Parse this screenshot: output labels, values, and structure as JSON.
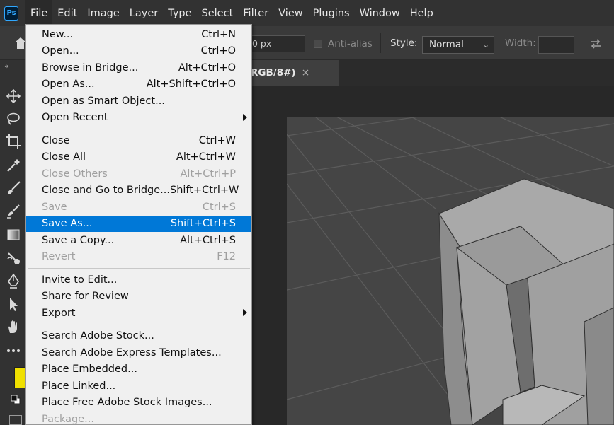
{
  "app": {
    "logo_text": "Ps"
  },
  "menubar": {
    "items": [
      "File",
      "Edit",
      "Image",
      "Layer",
      "Type",
      "Select",
      "Filter",
      "View",
      "Plugins",
      "Window",
      "Help"
    ]
  },
  "options": {
    "field_value": "0 px",
    "antialias_label": "Anti-alias",
    "style_label": "Style:",
    "style_value": "Normal",
    "width_label": "Width:"
  },
  "document": {
    "tab_title": "RGB/8#)",
    "close_glyph": "×"
  },
  "tools": {
    "collapse_glyph": "«"
  },
  "file_menu": {
    "groups": [
      [
        {
          "label": "New...",
          "shortcut": "Ctrl+N"
        },
        {
          "label": "Open...",
          "shortcut": "Ctrl+O"
        },
        {
          "label": "Browse in Bridge...",
          "shortcut": "Alt+Ctrl+O"
        },
        {
          "label": "Open As...",
          "shortcut": "Alt+Shift+Ctrl+O"
        },
        {
          "label": "Open as Smart Object...",
          "shortcut": ""
        },
        {
          "label": "Open Recent",
          "shortcut": "",
          "submenu": true
        }
      ],
      [
        {
          "label": "Close",
          "shortcut": "Ctrl+W"
        },
        {
          "label": "Close All",
          "shortcut": "Alt+Ctrl+W"
        },
        {
          "label": "Close Others",
          "shortcut": "Alt+Ctrl+P",
          "disabled": true
        },
        {
          "label": "Close and Go to Bridge...",
          "shortcut": "Shift+Ctrl+W"
        },
        {
          "label": "Save",
          "shortcut": "Ctrl+S",
          "disabled": true
        },
        {
          "label": "Save As...",
          "shortcut": "Shift+Ctrl+S",
          "highlighted": true
        },
        {
          "label": "Save a Copy...",
          "shortcut": "Alt+Ctrl+S"
        },
        {
          "label": "Revert",
          "shortcut": "F12",
          "disabled": true
        }
      ],
      [
        {
          "label": "Invite to Edit...",
          "shortcut": ""
        },
        {
          "label": "Share for Review",
          "shortcut": ""
        },
        {
          "label": "Export",
          "shortcut": "",
          "submenu": true
        }
      ],
      [
        {
          "label": "Search Adobe Stock...",
          "shortcut": ""
        },
        {
          "label": "Search Adobe Express Templates...",
          "shortcut": ""
        },
        {
          "label": "Place Embedded...",
          "shortcut": ""
        },
        {
          "label": "Place Linked...",
          "shortcut": ""
        },
        {
          "label": "Place Free Adobe Stock Images...",
          "shortcut": ""
        },
        {
          "label": "Package...",
          "shortcut": "",
          "disabled": true
        }
      ]
    ]
  },
  "colors": {
    "highlight": "#0078d7",
    "foreground_swatch": "#f0e000",
    "menubar_bg": "#323232"
  }
}
